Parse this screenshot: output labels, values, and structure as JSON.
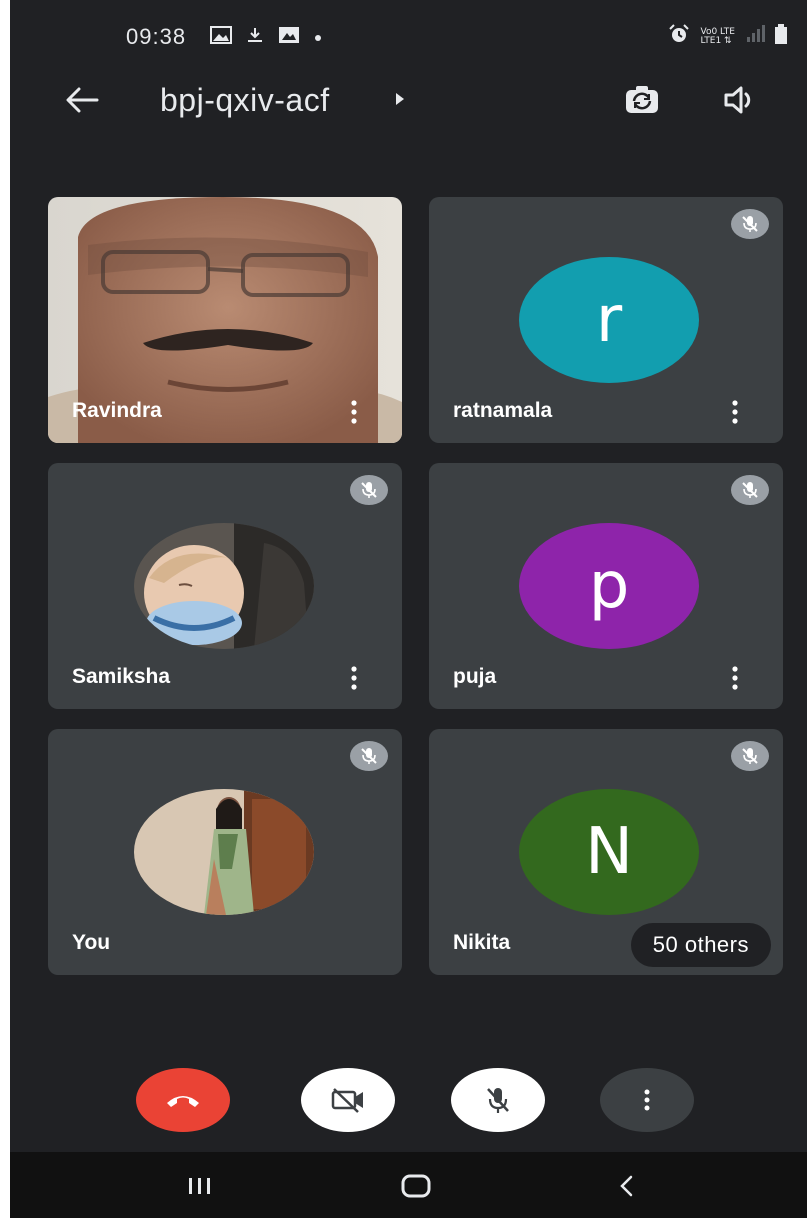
{
  "status_bar": {
    "time": "09:38",
    "network_label_top": "Vo0 LTE",
    "network_label_bottom": "LTE1 ⇅"
  },
  "header": {
    "meeting_code": "bpj-qxiv-acf"
  },
  "participants": [
    {
      "name": "Ravindra",
      "type": "video",
      "muted": false
    },
    {
      "name": "ratnamala",
      "type": "letter",
      "initial": "r",
      "avatar_color": "#129eaf",
      "muted": true
    },
    {
      "name": "Samiksha",
      "type": "photo",
      "muted": true
    },
    {
      "name": "puja",
      "type": "letter",
      "initial": "p",
      "avatar_color": "#8e24aa",
      "muted": true
    },
    {
      "name": "You",
      "type": "photo",
      "muted": true
    },
    {
      "name": "Nikita",
      "type": "letter",
      "initial": "N",
      "avatar_color": "#33691e",
      "muted": true
    }
  ],
  "others_chip": "50 others",
  "controls": {
    "end_call_color": "#ea4335"
  },
  "colors": {
    "background": "#202124",
    "tile": "#3c4043"
  }
}
